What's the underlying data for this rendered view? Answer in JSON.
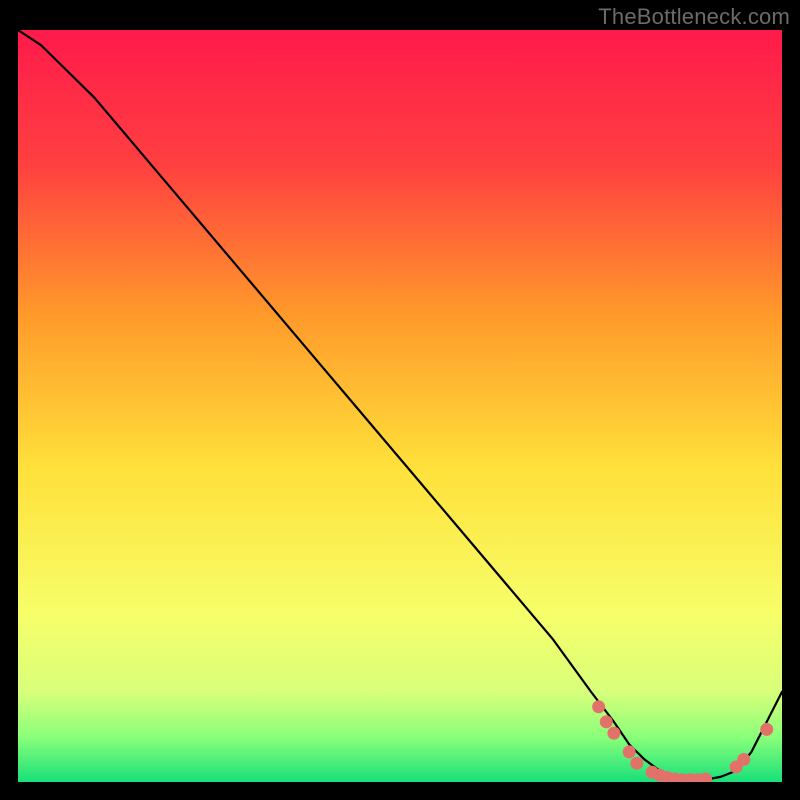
{
  "watermark": "TheBottleneck.com",
  "colors": {
    "frame_bg": "#000000",
    "grad_top": "#ff1a4b",
    "grad_mid1": "#ff7a2a",
    "grad_mid2": "#ffe63a",
    "grad_low1": "#f6ff8a",
    "grad_low2": "#9aff8a",
    "grad_bottom": "#18e07a",
    "curve": "#000000",
    "marker_fill": "#e2716a",
    "marker_stroke": "#c85a54"
  },
  "chart_data": {
    "type": "line",
    "title": "",
    "xlabel": "",
    "ylabel": "",
    "xlim": [
      0,
      100
    ],
    "ylim": [
      0,
      100
    ],
    "series": [
      {
        "name": "curve",
        "x": [
          0,
          3,
          6,
          10,
          20,
          30,
          40,
          50,
          60,
          70,
          75,
          78,
          80,
          82,
          84,
          86,
          88,
          90,
          92,
          94,
          96,
          100
        ],
        "y": [
          100,
          98,
          95,
          91,
          79,
          67,
          55,
          43,
          31,
          19,
          12,
          8,
          5,
          3,
          1.5,
          0.7,
          0.3,
          0.3,
          0.7,
          1.5,
          4,
          12
        ]
      }
    ],
    "markers": [
      {
        "x": 76,
        "y": 10
      },
      {
        "x": 77,
        "y": 8
      },
      {
        "x": 78,
        "y": 6.5
      },
      {
        "x": 80,
        "y": 4
      },
      {
        "x": 81,
        "y": 2.5
      },
      {
        "x": 83,
        "y": 1.3
      },
      {
        "x": 84,
        "y": 0.9
      },
      {
        "x": 85,
        "y": 0.6
      },
      {
        "x": 86,
        "y": 0.4
      },
      {
        "x": 87,
        "y": 0.3
      },
      {
        "x": 88,
        "y": 0.3
      },
      {
        "x": 89,
        "y": 0.3
      },
      {
        "x": 90,
        "y": 0.4
      },
      {
        "x": 94,
        "y": 2.0
      },
      {
        "x": 95,
        "y": 3.0
      },
      {
        "x": 98,
        "y": 7.0
      }
    ]
  }
}
